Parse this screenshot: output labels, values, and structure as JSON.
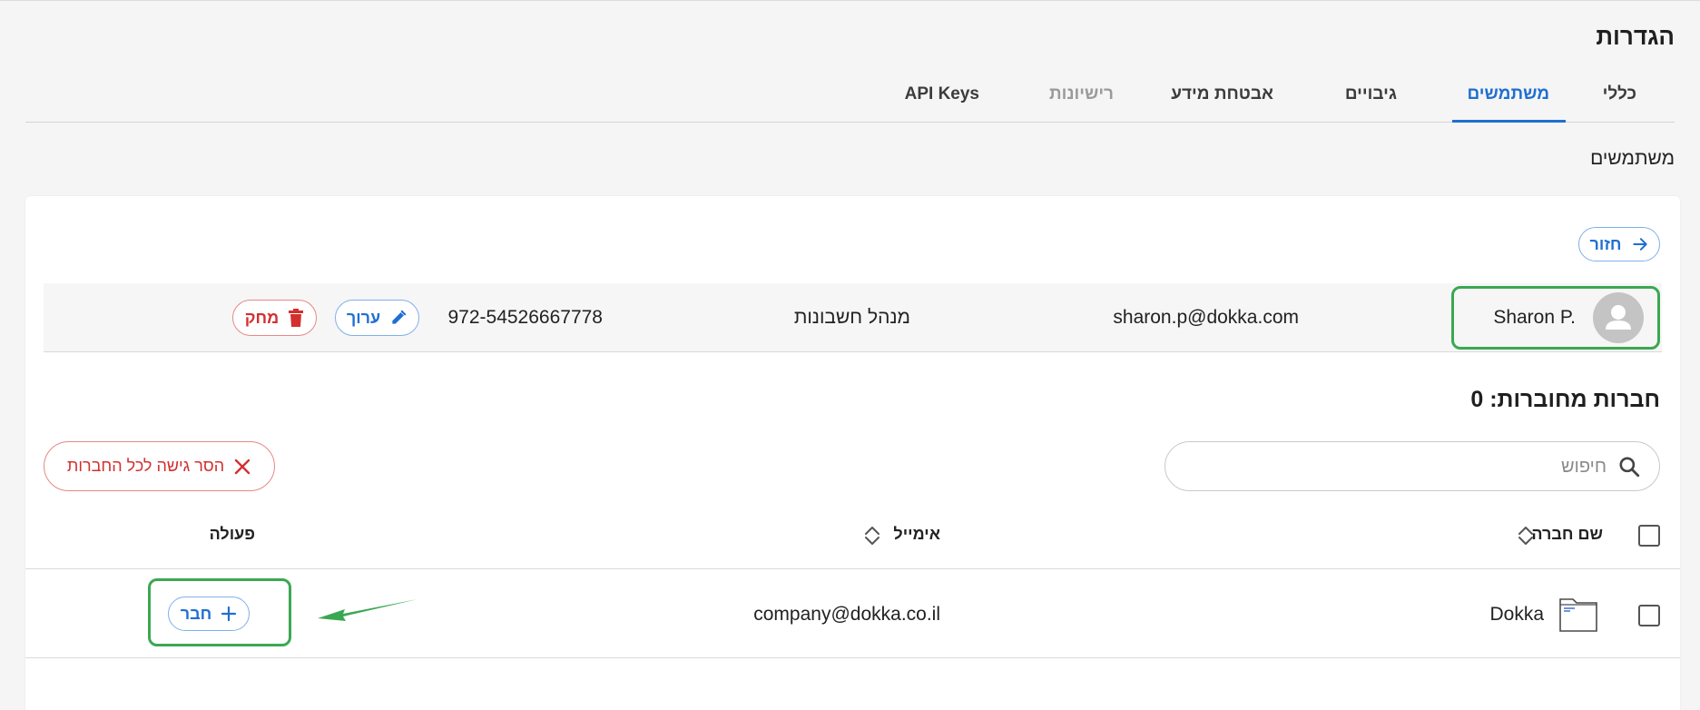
{
  "page": {
    "title": "הגדרות",
    "section_label": "משתמשים"
  },
  "tabs": [
    {
      "label": "כללי",
      "state": "default"
    },
    {
      "label": "משתמשים",
      "state": "active"
    },
    {
      "label": "גיבויים",
      "state": "default"
    },
    {
      "label": "אבטחת מידע",
      "state": "default"
    },
    {
      "label": "רישיונות",
      "state": "disabled"
    },
    {
      "label": "API Keys",
      "state": "default"
    }
  ],
  "back_button": {
    "label": "חזור",
    "icon": "arrow-right-icon"
  },
  "user": {
    "name": "Sharon P.",
    "email": "sharon.p@dokka.com",
    "role": "מנהל חשבונות",
    "phone": "972-54526667778",
    "avatar_icon": "person-icon",
    "edit_label": "ערוך",
    "delete_label": "מחק"
  },
  "companies": {
    "heading": "חברות מחוברות:",
    "count": "0",
    "search": {
      "placeholder": "חיפוש",
      "value": ""
    },
    "remove_all_label": "הסר גישה לכל החברות",
    "columns": {
      "name": "שם חברה",
      "email": "אימייל",
      "action": "פעולה"
    },
    "rows": [
      {
        "name": "Dokka",
        "email": "company@dokka.co.il",
        "action_label": "חבר",
        "icon": "folder-icon"
      }
    ]
  },
  "colors": {
    "accent": "#1f6fd1",
    "danger": "#d42f2f",
    "highlight": "#3aa853"
  }
}
